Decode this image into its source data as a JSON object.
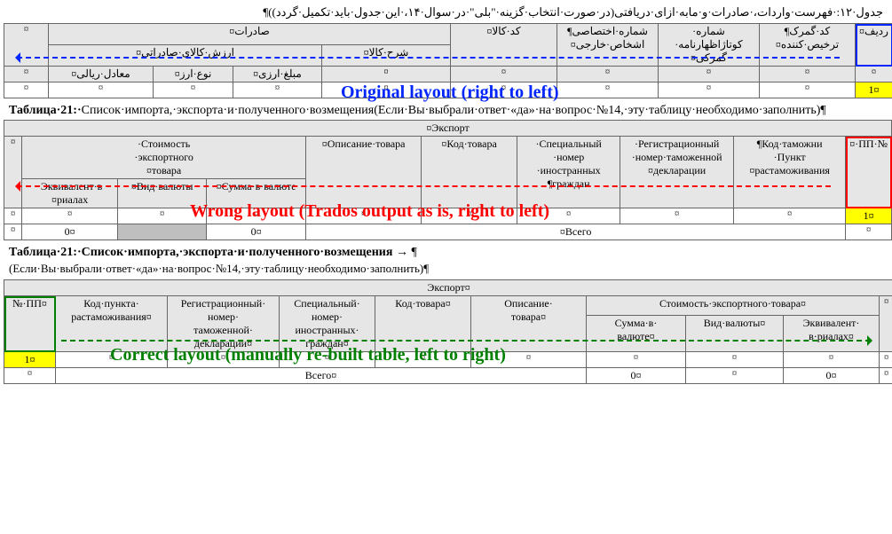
{
  "marks": {
    "cell": "¤",
    "para": "¶",
    "dot": "·",
    "arrow_rl": " → "
  },
  "annotations": {
    "blue": "Original layout (right to left)",
    "red": "Wrong layout (Trados output as is, right to left)",
    "green": "Correct layout (manually re-built table, left to right)"
  },
  "table1": {
    "title": "جدول·۱۲:·فهرست·واردات،·صادرات·و·مابه·ازای·دریافتی(در·صورت·انتخاب·گزینه·\"بلی\"·در·سوال·۱۴،·این·جدول·باید·تکمیل·گردد))¶",
    "export": "صادرات¤",
    "headers": {
      "seq": "ردیف¤",
      "customs_code": "کد·گمرک¶\nترخیص·کننده¤",
      "decl_no": "شماره·\nکوتاژاظهارنامه·\nگمرکی¤",
      "foreign_no": "شماره·اختصاصی¶\nاشخاص·خارجی¤",
      "item_code": "کد·کالا¤",
      "item_desc": "شرح·کالا¤",
      "export_value": "ارزش·کالای·صادراتی¤",
      "fx_amount": "مبلغ·ارزی¤",
      "fx_type": "نوع·ارز¤",
      "rial_eq": "معادل·ریالی¤"
    },
    "row": {
      "seq": "1¤"
    }
  },
  "table2": {
    "title_prefix": "Таблица·21:·",
    "title_rest": "Список·импорта,·экспорта·и·полученного·возмещения(Если·Вы·выбрали·ответ·«да»·на·вопрос·№14,·эту·таблицу·необходимо·заполнить)¶",
    "export": "Экспорт¤",
    "headers": {
      "seq": "№·ПП·¤",
      "customs_code": "Код·таможни¶\nПункт·\nрастаможивания¤",
      "decl_no": "Регистрационный·\nномер·таможенной·\nдекларации¤",
      "foreign_no": "Специальный·\nномер·\nиностранных·\nграждан¶",
      "item_code": "Код·товара¤",
      "item_desc": "Описание·товара¤",
      "export_value": "Стоимость·\nэкспортного·\nтовара¤",
      "fx_amount": "Сумма·в·валюте¤",
      "fx_type": "Вид·валюты¤",
      "rial_eq": "Эквивалент·в·\nриалах¤"
    },
    "row": {
      "seq": "1¤",
      "zero": "0¤"
    },
    "total": "Всего¤"
  },
  "table3": {
    "title_bold": "Таблица·21:·Список·импорта,·экспорта·и·полученного·возмещения",
    "title_tail": " → ¶",
    "subtitle": "(Если·Вы·выбрали·ответ·«да»·на·вопрос·№14,·эту·таблицу·необходимо·заполнить)¶",
    "export": "Экспорт¤",
    "headers": {
      "seq": "№·ПП¤",
      "customs_code": "Код·пункта·\nрастаможивания¤",
      "decl_no": "Регистрационный·\nномер·\nтаможенной·\nдекларации¤",
      "foreign_no": "Специальный·\nномер·\nиностранных·\nграждан¤",
      "item_code": "Код·товара¤",
      "item_desc": "Описание·\nтовара¤",
      "export_value": "Стоимость·экспортного·товара¤",
      "fx_amount": "Сумма·в·\nвалюте¤",
      "fx_type": "Вид·валюты¤",
      "rial_eq": "Эквивалент·\nв·риалах¤"
    },
    "row": {
      "seq": "1¤",
      "zero": "0¤"
    },
    "total": "Всего¤"
  }
}
